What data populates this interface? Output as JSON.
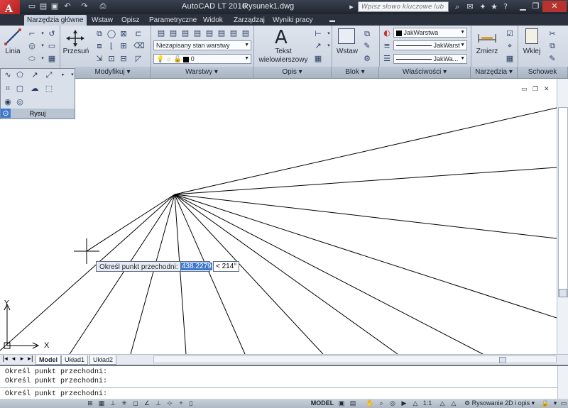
{
  "titlebar": {
    "app_title": "AutoCAD LT 2010",
    "document": "Rysunek1.dwg",
    "search_placeholder": "Wpisz słowo kluczowe lub frazę"
  },
  "tabs": [
    {
      "label": "Narzędzia główne",
      "active": true
    },
    {
      "label": "Wstaw"
    },
    {
      "label": "Opisz"
    },
    {
      "label": "Parametryczne"
    },
    {
      "label": "Widok"
    },
    {
      "label": "Zarządzaj"
    },
    {
      "label": "Wyniki pracy"
    }
  ],
  "ribbon": {
    "line_label": "Linia",
    "move_label": "Przesuń",
    "text_label_1": "Tekst",
    "text_label_2": "wielowierszowy",
    "insert_label": "Wstaw",
    "measure_label": "Zmierz",
    "paste_label": "Wklej",
    "layer_state": "Niezapisany stan warstwy",
    "layer_current": "0",
    "prop_color": "JakWarstwa",
    "prop_linetype": "JakWarst",
    "prop_lineweight": "JakWa...",
    "panels": {
      "modify": "Modyfikuj ▾",
      "layers": "Warstwy ▾",
      "annotate": "Opis ▾",
      "block": "Blok ▾",
      "properties": "Właściwości ▾",
      "utilities": "Narzędzia ▾",
      "clipboard": "Schowek"
    },
    "draw_panel_label": "Rysuj"
  },
  "canvas": {
    "dyn_prompt": "Określ punkt przechodni:",
    "dyn_length": "438.2279",
    "dyn_angle": "< 214°",
    "ucs_x": "X",
    "ucs_y": "Y"
  },
  "layout_tabs": [
    "Model",
    "Układ1",
    "Układ2"
  ],
  "command_lines": [
    "Określ punkt przechodni:",
    "Określ punkt przechodni:",
    "Określ punkt przechodni:"
  ],
  "status": {
    "model": "MODEL",
    "scale": "1:1",
    "workspace": "Rysowanie 2D i opis"
  }
}
